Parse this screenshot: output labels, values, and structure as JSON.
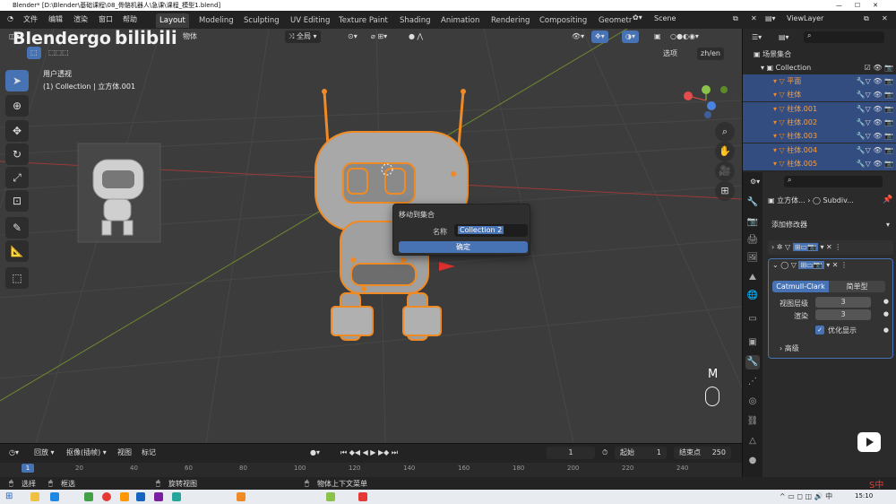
{
  "window": {
    "title": "Blender* [D:\\Blender\\基础课程\\08_骨骼机器人\\急课\\课程_模型1.blend]"
  },
  "menu": {
    "file": "文件",
    "edit": "编辑",
    "render": "渲染",
    "window": "窗口",
    "help": "帮助"
  },
  "workspaces": [
    "Layout",
    "Modeling",
    "Sculpting",
    "UV Editing",
    "Texture Paint",
    "Shading",
    "Animation",
    "Rendering",
    "Compositing",
    "Geometr"
  ],
  "scene": {
    "name": "Scene",
    "view_layer": "ViewLayer"
  },
  "watermark": {
    "text": "Blendergo",
    "logo": "bilibili"
  },
  "viewport": {
    "object_menu": "物体",
    "orientation": "全局",
    "options": "选项",
    "lang_toggle": "zh/en",
    "view_name": "用户透视",
    "collection_info": "(1) Collection | 立方体.001",
    "key_overlay": "M"
  },
  "dialog": {
    "title": "移动到集合",
    "name_label": "名称",
    "name_value": "Collection 2",
    "confirm": "确定"
  },
  "outliner": {
    "scene_collection": "场景集合",
    "collection": "Collection",
    "items": [
      "平面",
      "柱体",
      "柱体.001",
      "柱体.002",
      "柱体.003",
      "柱体.004",
      "柱体.005"
    ]
  },
  "properties": {
    "breadcrumb_object": "立方体...",
    "breadcrumb_modifier": "Subdiv...",
    "add_modifier": "添加修改器",
    "subdiv_tabs": [
      "Catmull-Clark",
      "简单型"
    ],
    "viewport_levels_label": "视图层级",
    "viewport_levels": "3",
    "render_label": "渲染",
    "render_levels": "3",
    "optimize_display": "优化显示",
    "advanced": "高级"
  },
  "timeline": {
    "playback": "回放",
    "keying": "抠像(插帧)",
    "view": "视图",
    "marker": "标记",
    "current_frame": "1",
    "start_label": "起始",
    "start": "1",
    "end_label": "结束点",
    "end": "250",
    "ticks": [
      "20",
      "40",
      "60",
      "80",
      "100",
      "120",
      "140",
      "160",
      "180",
      "200",
      "220",
      "240"
    ],
    "playhead": "1"
  },
  "status": {
    "select": "选择",
    "box_select": "框选",
    "rotate_view": "旋转视图",
    "context_menu": "物体上下文菜单"
  },
  "taskbar": {
    "time": "15:10"
  },
  "colors": {
    "accent": "#4772b3",
    "selection": "#f08a24",
    "outliner_sel": "#334d80"
  }
}
